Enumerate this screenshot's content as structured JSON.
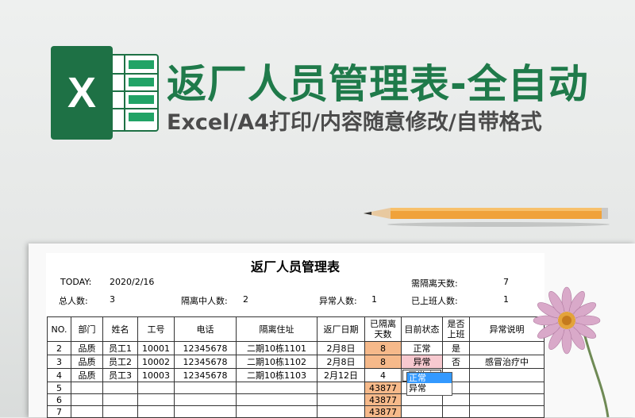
{
  "banner": {
    "logo_letter": "X",
    "title": "返厂人员管理表-全自动",
    "subtitle": "Excel/A4打印/内容随意修改/自带格式"
  },
  "sheet": {
    "title": "返厂人员管理表",
    "today_label": "TODAY:",
    "today_value": "2020/2/16",
    "quarantine_days_label": "需隔离天数:",
    "quarantine_days_value": "7",
    "total_label": "总人数:",
    "total_value": "3",
    "isolating_label": "隔离中人数:",
    "isolating_value": "2",
    "abnormal_label": "异常人数:",
    "abnormal_value": "1",
    "onduty_label": "已上班人数:",
    "onduty_value": "1",
    "headers": [
      "NO.",
      "部门",
      "姓名",
      "工号",
      "电话",
      "隔离住址",
      "返厂日期",
      "已隔离天数",
      "目前状态",
      "是否上班",
      "异常说明"
    ],
    "rows": [
      [
        "2",
        "品质",
        "员工1",
        "10001",
        "12345678",
        "二期10栋1101",
        "2月8日",
        "8",
        "正常",
        "是",
        ""
      ],
      [
        "3",
        "品质",
        "员工2",
        "10002",
        "12345678",
        "二期10栋1102",
        "2月8日",
        "8",
        "异常",
        "否",
        "感冒治疗中"
      ],
      [
        "4",
        "品质",
        "员工3",
        "10003",
        "12345678",
        "二期10栋1103",
        "2月12日",
        "4",
        "正常",
        "",
        ""
      ],
      [
        "5",
        "",
        "",
        "",
        "",
        "",
        "",
        "43877",
        "",
        "",
        ""
      ],
      [
        "6",
        "",
        "",
        "",
        "",
        "",
        "",
        "43877",
        "",
        "",
        ""
      ],
      [
        "7",
        "",
        "",
        "",
        "",
        "",
        "",
        "43877",
        "",
        "",
        ""
      ]
    ],
    "dropdown_options": [
      "正常",
      "异常"
    ],
    "colors": {
      "days_fill": "#f6b98a",
      "abnormal_fill": "#f7c9cf",
      "abnormal_text": "#c00000",
      "brand_green": "#1e7145",
      "dropdown_highlight": "#3399ff"
    }
  }
}
